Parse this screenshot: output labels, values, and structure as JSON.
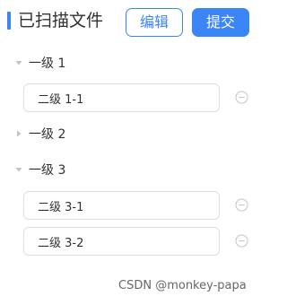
{
  "header": {
    "title": "已扫描文件",
    "edit_label": "编辑",
    "submit_label": "提交"
  },
  "colors": {
    "accent": "#3b86f6",
    "border": "#dcdfe6",
    "text": "#303133",
    "icon_gray": "#c0c4cc"
  },
  "tree": [
    {
      "label": "一级 1",
      "expanded": true,
      "children": [
        {
          "value": "二级 1-1",
          "action_icon": "remove-circle-icon"
        }
      ]
    },
    {
      "label": "一级 2",
      "expanded": false,
      "children": []
    },
    {
      "label": "一级 3",
      "expanded": true,
      "children": [
        {
          "value": "二级 3-1",
          "action_icon": "remove-circle-icon"
        },
        {
          "value": "二级 3-2",
          "action_icon": "remove-circle-icon"
        }
      ]
    }
  ],
  "watermark": "CSDN @monkey-papa"
}
